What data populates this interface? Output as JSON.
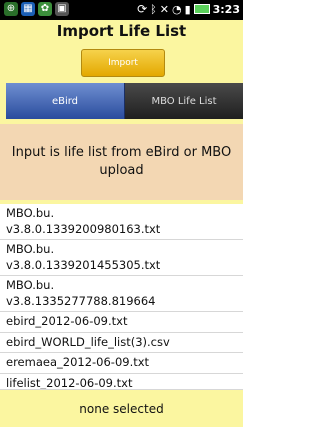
{
  "statusbar": {
    "time": "3:23"
  },
  "screen": {
    "title": "Import Life List",
    "import_button": "Import",
    "tabs": [
      {
        "label": "eBird"
      },
      {
        "label": "MBO Life List"
      }
    ],
    "info_text": "Input is life list from eBird or MBO upload"
  },
  "files": [
    {
      "name": "MBO.bu.\nv3.8.0.1339200980163.txt"
    },
    {
      "name": "MBO.bu.\nv3.8.0.1339201455305.txt"
    },
    {
      "name": "MBO.bu.\nv3.8.1335277788.819664"
    },
    {
      "name": "ebird_2012-06-09.txt"
    },
    {
      "name": "ebird_WORLD_life_list(3).csv"
    },
    {
      "name": "eremaea_2012-06-09.txt"
    },
    {
      "name": "lifelist_2012-06-09.txt"
    }
  ],
  "footer": {
    "selection_status": "none selected"
  }
}
